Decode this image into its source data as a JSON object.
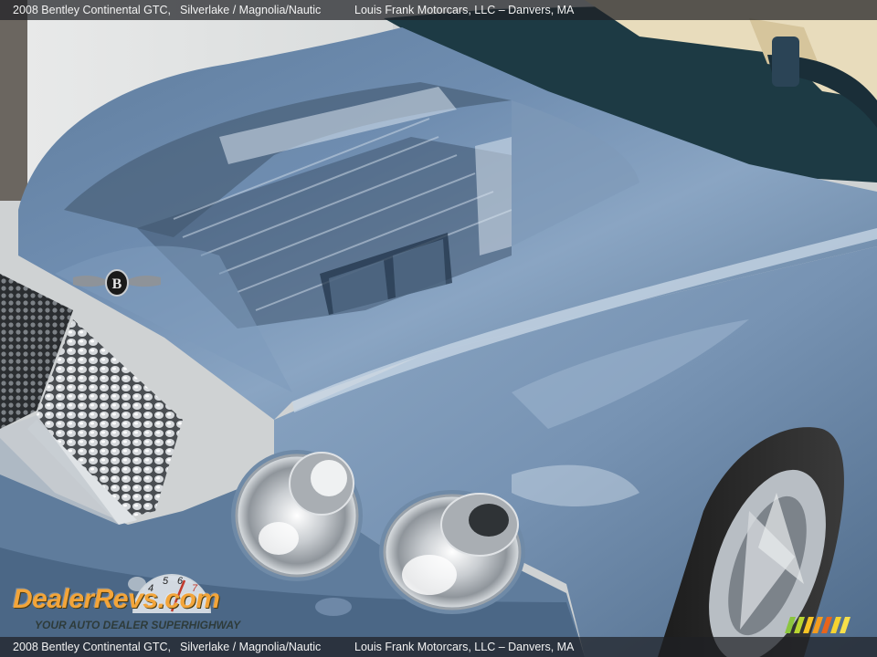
{
  "caption": {
    "vehicle": "2008 Bentley Continental GTC,",
    "color": "Silverlake",
    "slash": "/",
    "interior": "Magnolia/Nautic",
    "dealer": "Louis Frank Motorcars, LLC",
    "dash": "–",
    "location": "Danvers, MA"
  },
  "watermark": {
    "brand": "DealerRevs.com",
    "tagline": "YOUR AUTO DEALER SUPERHIGHWAY",
    "gauge_digits": [
      "4",
      "5",
      "6",
      "7"
    ]
  },
  "colors": {
    "paint": "#7f9cbc",
    "paint_shadow": "#3f5a78",
    "watermark_orange": "#f3a53a",
    "caption_bg": "#1e2024"
  },
  "icons": [
    "bentley-badge-icon",
    "speedometer-icon",
    "colored-bars-logo-icon"
  ]
}
